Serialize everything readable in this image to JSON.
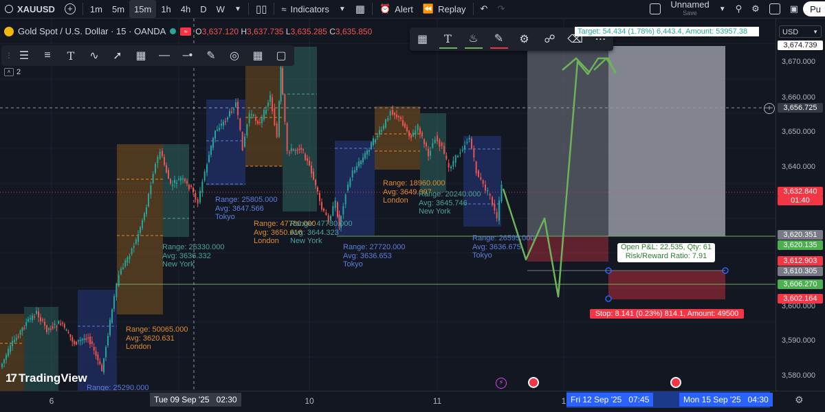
{
  "topbar": {
    "symbol": "XAUUSD",
    "intervals": [
      "1m",
      "5m",
      "15m",
      "1h",
      "4h",
      "D",
      "W"
    ],
    "active_interval": "15m",
    "indicators_label": "Indicators",
    "alert_label": "Alert",
    "replay_label": "Replay",
    "layout_name": "Unnamed",
    "save_label": "Save",
    "publish_label": "Pu"
  },
  "legend": {
    "title": "Gold Spot / U.S. Dollar · 15 · OANDA",
    "o_label": "O",
    "o": "3,637.120",
    "h_label": "H",
    "h": "3,637.735",
    "l_label": "L",
    "l": "3,635.285",
    "c_label": "C",
    "c": "3,635.850",
    "indicator_count": "2"
  },
  "price_axis": {
    "currency": "USD",
    "ticks": [
      "3,670.000",
      "3,660.000",
      "3,650.000",
      "3,640.000",
      "3,600.000",
      "3,590.000",
      "3,580.000"
    ],
    "badges": {
      "target": "3,674.739",
      "crosshair": "3,656.725",
      "last": "3,632.840",
      "countdown": "01:40",
      "entry": "3,620.351",
      "line1": "3,620.135",
      "red1": "3,612.903",
      "entry2": "3,610.305",
      "line2": "3,606.270",
      "stop": "3,602.164"
    }
  },
  "time_axis": {
    "ticks": [
      "6",
      "10",
      "11",
      "1"
    ],
    "crosshair_label": "Tue 09 Sep '25   02:30",
    "range_start": "Fri 12 Sep '25   07:45",
    "range_end": "Mon 15 Sep '25   04:30"
  },
  "sessions": [
    {
      "id": "s1",
      "range": "Range: 50065.000",
      "avg": "Avg: 3620.631",
      "name": "London",
      "kind": "london"
    },
    {
      "id": "s2",
      "range": "Range: 26330.000",
      "avg": "Avg: 3636.332",
      "name": "New York",
      "kind": "ny"
    },
    {
      "id": "s3",
      "range": "Range: 25805.000",
      "avg": "Avg: 3647.566",
      "name": "Tokyo",
      "kind": "tokyo"
    },
    {
      "id": "s4",
      "range": "Range: 47780.000",
      "avg": "Avg: 3650.616",
      "name": "London",
      "kind": "london"
    },
    {
      "id": "s5",
      "range": "Range: 47780.000",
      "avg": "Avg: 3644.323",
      "name": "New York",
      "kind": "ny"
    },
    {
      "id": "s6",
      "range": "Range: 27720.000",
      "avg": "Avg: 3636.653",
      "name": "Tokyo",
      "kind": "tokyo"
    },
    {
      "id": "s7",
      "range": "Range: 18960.000",
      "avg": "Avg: 3649.097",
      "name": "London",
      "kind": "london"
    },
    {
      "id": "s8",
      "range": "Range: 20240.000",
      "avg": "Avg: 3645.746",
      "name": "New York",
      "kind": "ny"
    },
    {
      "id": "s9",
      "range": "Range: 26595.000",
      "avg": "Avg: 3636.675",
      "name": "Tokyo",
      "kind": "tokyo"
    },
    {
      "id": "s10",
      "range": "Range: 25290.000",
      "avg": "",
      "name": "",
      "kind": "tokyo"
    }
  ],
  "position": {
    "target_label": "Target: 54.434 (1.78%) 6,443.4, Amount: 53957.38",
    "pnl_line1": "Open P&L: 22.535, Qty: 61",
    "pnl_line2": "Risk/Reward Ratio: 7.91",
    "stop_label": "Stop: 8.141 (0.23%) 814.1, Amount: 49500"
  },
  "brand": "TradingView",
  "colors": {
    "bg": "#131722",
    "up": "#26a69a",
    "down": "#ef5350",
    "tokyo": "#5b7fe0",
    "london": "#e08a2a",
    "newyork": "#4aa39a",
    "projection": "#6db35a",
    "accent": "#2962ff"
  }
}
